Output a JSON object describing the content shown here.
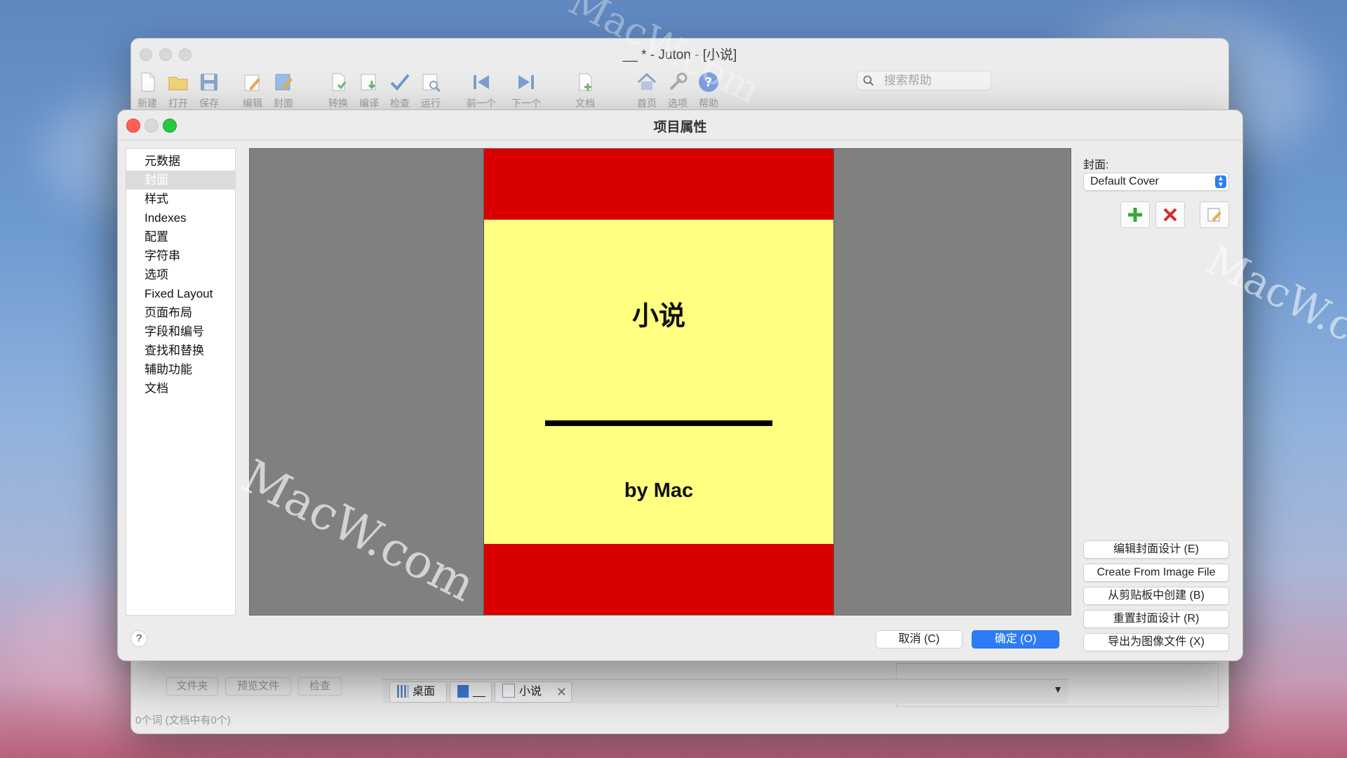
{
  "main_window": {
    "title": "__ * - Juton - [小说]",
    "toolbar": [
      {
        "label": "新建",
        "icon": "new-document-icon"
      },
      {
        "label": "打开",
        "icon": "open-folder-icon"
      },
      {
        "label": "保存",
        "icon": "save-disk-icon"
      },
      {
        "label": "编辑",
        "icon": "edit-pencil-icon"
      },
      {
        "label": "封面",
        "icon": "cover-icon"
      },
      {
        "label": "转换",
        "icon": "convert-icon"
      },
      {
        "label": "编译",
        "icon": "compile-icon"
      },
      {
        "label": "检查",
        "icon": "checkmark-icon"
      },
      {
        "label": "运行",
        "icon": "run-icon"
      },
      {
        "label": "前一个",
        "icon": "previous-icon"
      },
      {
        "label": "下一个",
        "icon": "next-icon"
      },
      {
        "label": "文档",
        "icon": "document-add-icon"
      },
      {
        "label": "首页",
        "icon": "home-icon"
      },
      {
        "label": "选项",
        "icon": "tools-icon"
      },
      {
        "label": "帮助",
        "icon": "help-icon"
      }
    ],
    "search_placeholder": "搜索帮助",
    "bottom_buttons": [
      "文件夹",
      "预览文件",
      "检查"
    ],
    "tabs": [
      {
        "label": "桌面"
      },
      {
        "label": "__"
      },
      {
        "label": "小说"
      }
    ],
    "status": "0个词 (文档中有0个)"
  },
  "dialog": {
    "title": "项目属性",
    "sidebar": [
      "元数据",
      "封面",
      "样式",
      "Indexes",
      "配置",
      "字符串",
      "选项",
      "Fixed Layout",
      "页面布局",
      "字段和编号",
      "查找和替换",
      "辅助功能",
      "文档"
    ],
    "selected_index": 1,
    "cover_preview": {
      "title": "小说",
      "author": "by Mac",
      "colors": {
        "band": "#db0000",
        "body": "#ffff80",
        "background": "#808080"
      }
    },
    "cover_label": "封面:",
    "cover_select": "Default Cover",
    "actions": [
      "编辑封面设计 (E)",
      "Create From Image File",
      "从剪贴板中创建 (B)",
      "重置封面设计 (R)",
      "导出为图像文件 (X)"
    ],
    "help": "?",
    "cancel": "取消 (C)",
    "ok": "确定 (O)"
  },
  "watermark": "MacW.com"
}
